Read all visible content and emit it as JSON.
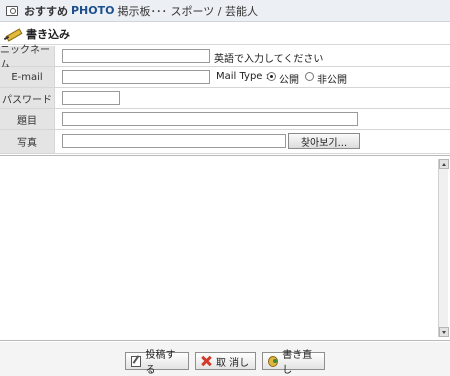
{
  "header": {
    "title_a": "おすすめ",
    "title_b": "PHOTO",
    "title_c": "掲示板･･･ スポーツ / 芸能人"
  },
  "section": {
    "label": "書き込み"
  },
  "form": {
    "nickname_label": "ニックネーム",
    "nickname_value": "",
    "nickname_note": "英語で入力してください",
    "email_label": "E-mail",
    "email_value": "",
    "mail_type_label": "Mail Type :",
    "mail_type_public": "公開",
    "mail_type_private": "非公開",
    "mail_type_selected": "公開",
    "password_label": "パスワード",
    "password_value": "",
    "subject_label": "題目",
    "subject_value": "",
    "photo_label": "写真",
    "photo_value": "",
    "browse_label": "찾아보기...",
    "body_value": ""
  },
  "buttons": {
    "post": "投稿する",
    "cancel": "取 消し",
    "rewrite": "書き直し"
  }
}
